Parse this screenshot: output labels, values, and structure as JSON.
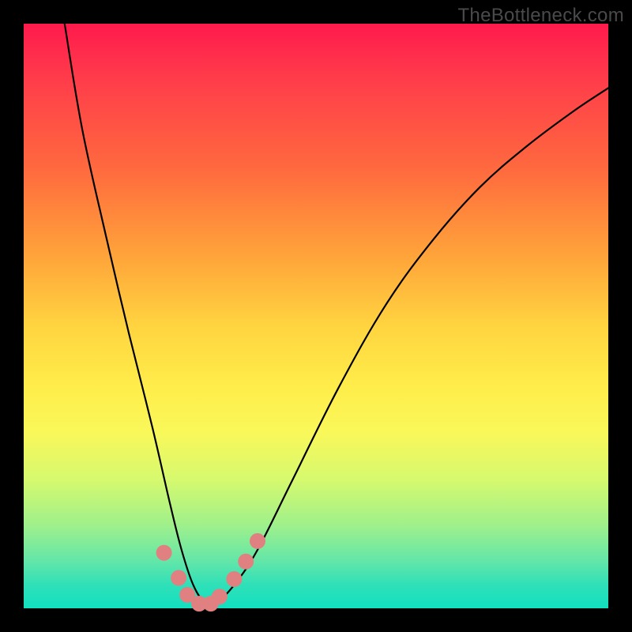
{
  "watermark": "TheBottleneck.com",
  "chart_data": {
    "type": "line",
    "title": "",
    "xlabel": "",
    "ylabel": "",
    "xlim": [
      0,
      100
    ],
    "ylim": [
      0,
      100
    ],
    "grid": false,
    "background_gradient": [
      "#ff1a4d",
      "#ffed4a",
      "#11e0c1"
    ],
    "series": [
      {
        "name": "bottleneck-curve",
        "color": "#000000",
        "x": [
          7,
          10,
          14,
          18,
          22,
          25,
          27,
          29,
          31,
          33,
          36,
          40,
          46,
          54,
          62,
          70,
          78,
          86,
          94,
          100
        ],
        "values": [
          100,
          82,
          64,
          47,
          31,
          18,
          10,
          4,
          1,
          1,
          4,
          10,
          22,
          38,
          52,
          63,
          72,
          79,
          85,
          89
        ]
      }
    ],
    "markers": [
      {
        "name": "highlight-dots",
        "color": "#e08080",
        "shape": "circle",
        "radius_px": 10,
        "x": [
          24,
          26.5,
          28,
          30,
          32,
          33.5,
          36,
          38,
          40
        ],
        "values": [
          9.5,
          5.2,
          2.3,
          0.8,
          0.8,
          2.0,
          5.0,
          8.0,
          11.5
        ]
      }
    ]
  }
}
